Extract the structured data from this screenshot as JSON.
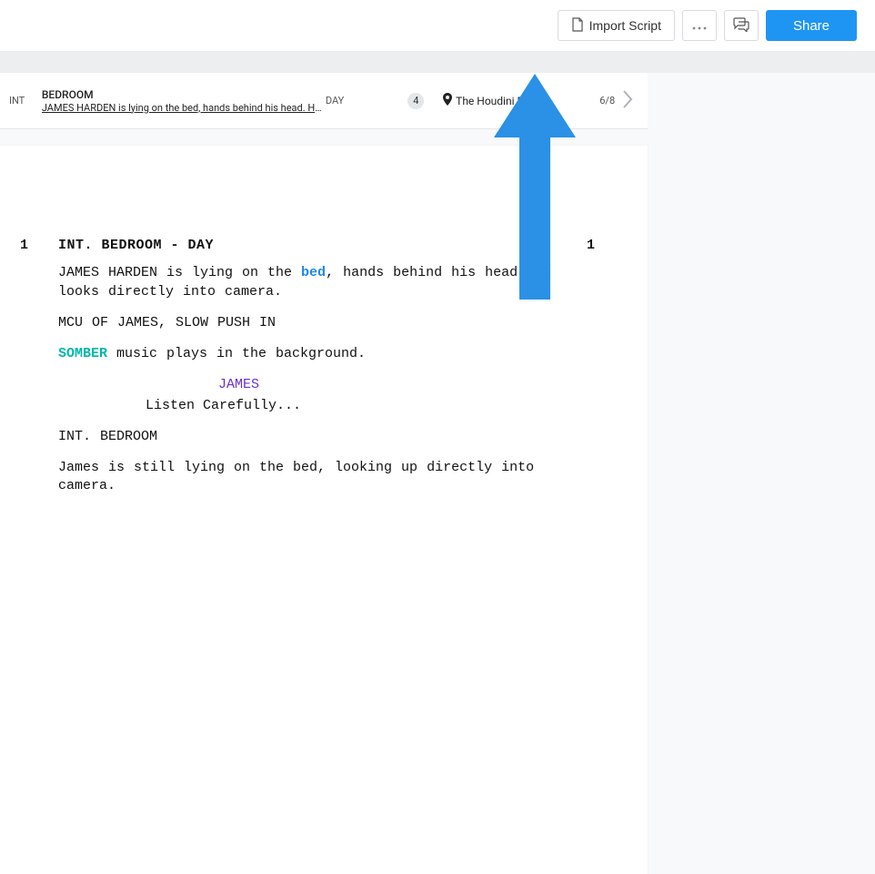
{
  "toolbar": {
    "import_label": "Import Script",
    "share_label": "Share"
  },
  "scene_info": {
    "int_ext": "INT",
    "set_name": "BEDROOM",
    "description": "JAMES HARDEN is lying on the bed, hands behind his head. He looks...",
    "time_of_day": "DAY",
    "scene_number": "4",
    "location": "The Houdini Estate",
    "page": "6/8"
  },
  "script": {
    "scene_num_left": "1",
    "scene_num_right": "1",
    "slugline": "INT. BEDROOM - DAY",
    "action1_pre": "JAMES HARDEN is lying on the ",
    "action1_tag": "bed",
    "action1_post": ", hands behind his head. He looks directly into camera.",
    "action2": "MCU OF JAMES, SLOW PUSH IN",
    "action3_tag": "SOMBER",
    "action3_post": " music plays in the background.",
    "character1": "JAMES",
    "dialogue1": "Listen Carefully...",
    "slugline2": "INT. BEDROOM",
    "action4": "James is still lying on the bed, looking up directly into camera."
  },
  "colors": {
    "accent": "#1e95f3"
  }
}
